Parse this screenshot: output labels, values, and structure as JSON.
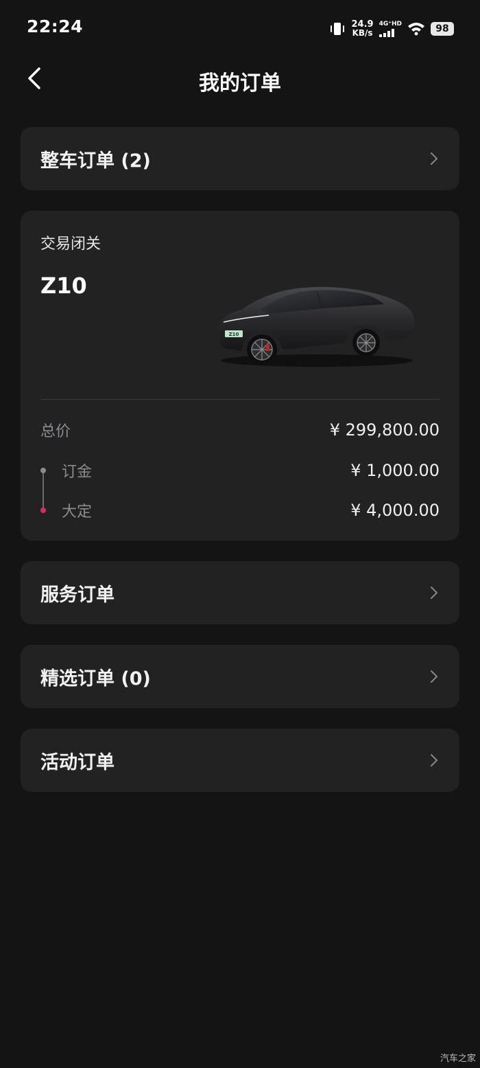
{
  "status_bar": {
    "time": "22:24",
    "net_speed_value": "24.9",
    "net_speed_unit": "KB/s",
    "cell_label": "4G⁺HD",
    "battery": "98",
    "icons": [
      "vibrate-icon",
      "cell-signal-icon",
      "wifi-icon",
      "battery-icon"
    ]
  },
  "nav": {
    "title": "我的订单",
    "back_icon": "chevron-left-icon"
  },
  "vehicle_orders": {
    "label": "整车订单 (2)"
  },
  "order": {
    "status": "交易闭关",
    "model": "Z10",
    "total_label": "总价",
    "total_value": "¥ 299,800.00",
    "deposit_label": "订金",
    "deposit_value": "¥ 1,000.00",
    "big_deposit_label": "大定",
    "big_deposit_value": "¥ 4,000.00",
    "plate_text": "Z10"
  },
  "service_orders": {
    "label": "服务订单"
  },
  "selected_orders": {
    "label": "精选订单 (0)"
  },
  "activity_orders": {
    "label": "活动订单"
  },
  "watermark": "汽车之家",
  "colors": {
    "background": "#141414",
    "card": "#222223",
    "accent_dot": "#e5245d"
  }
}
